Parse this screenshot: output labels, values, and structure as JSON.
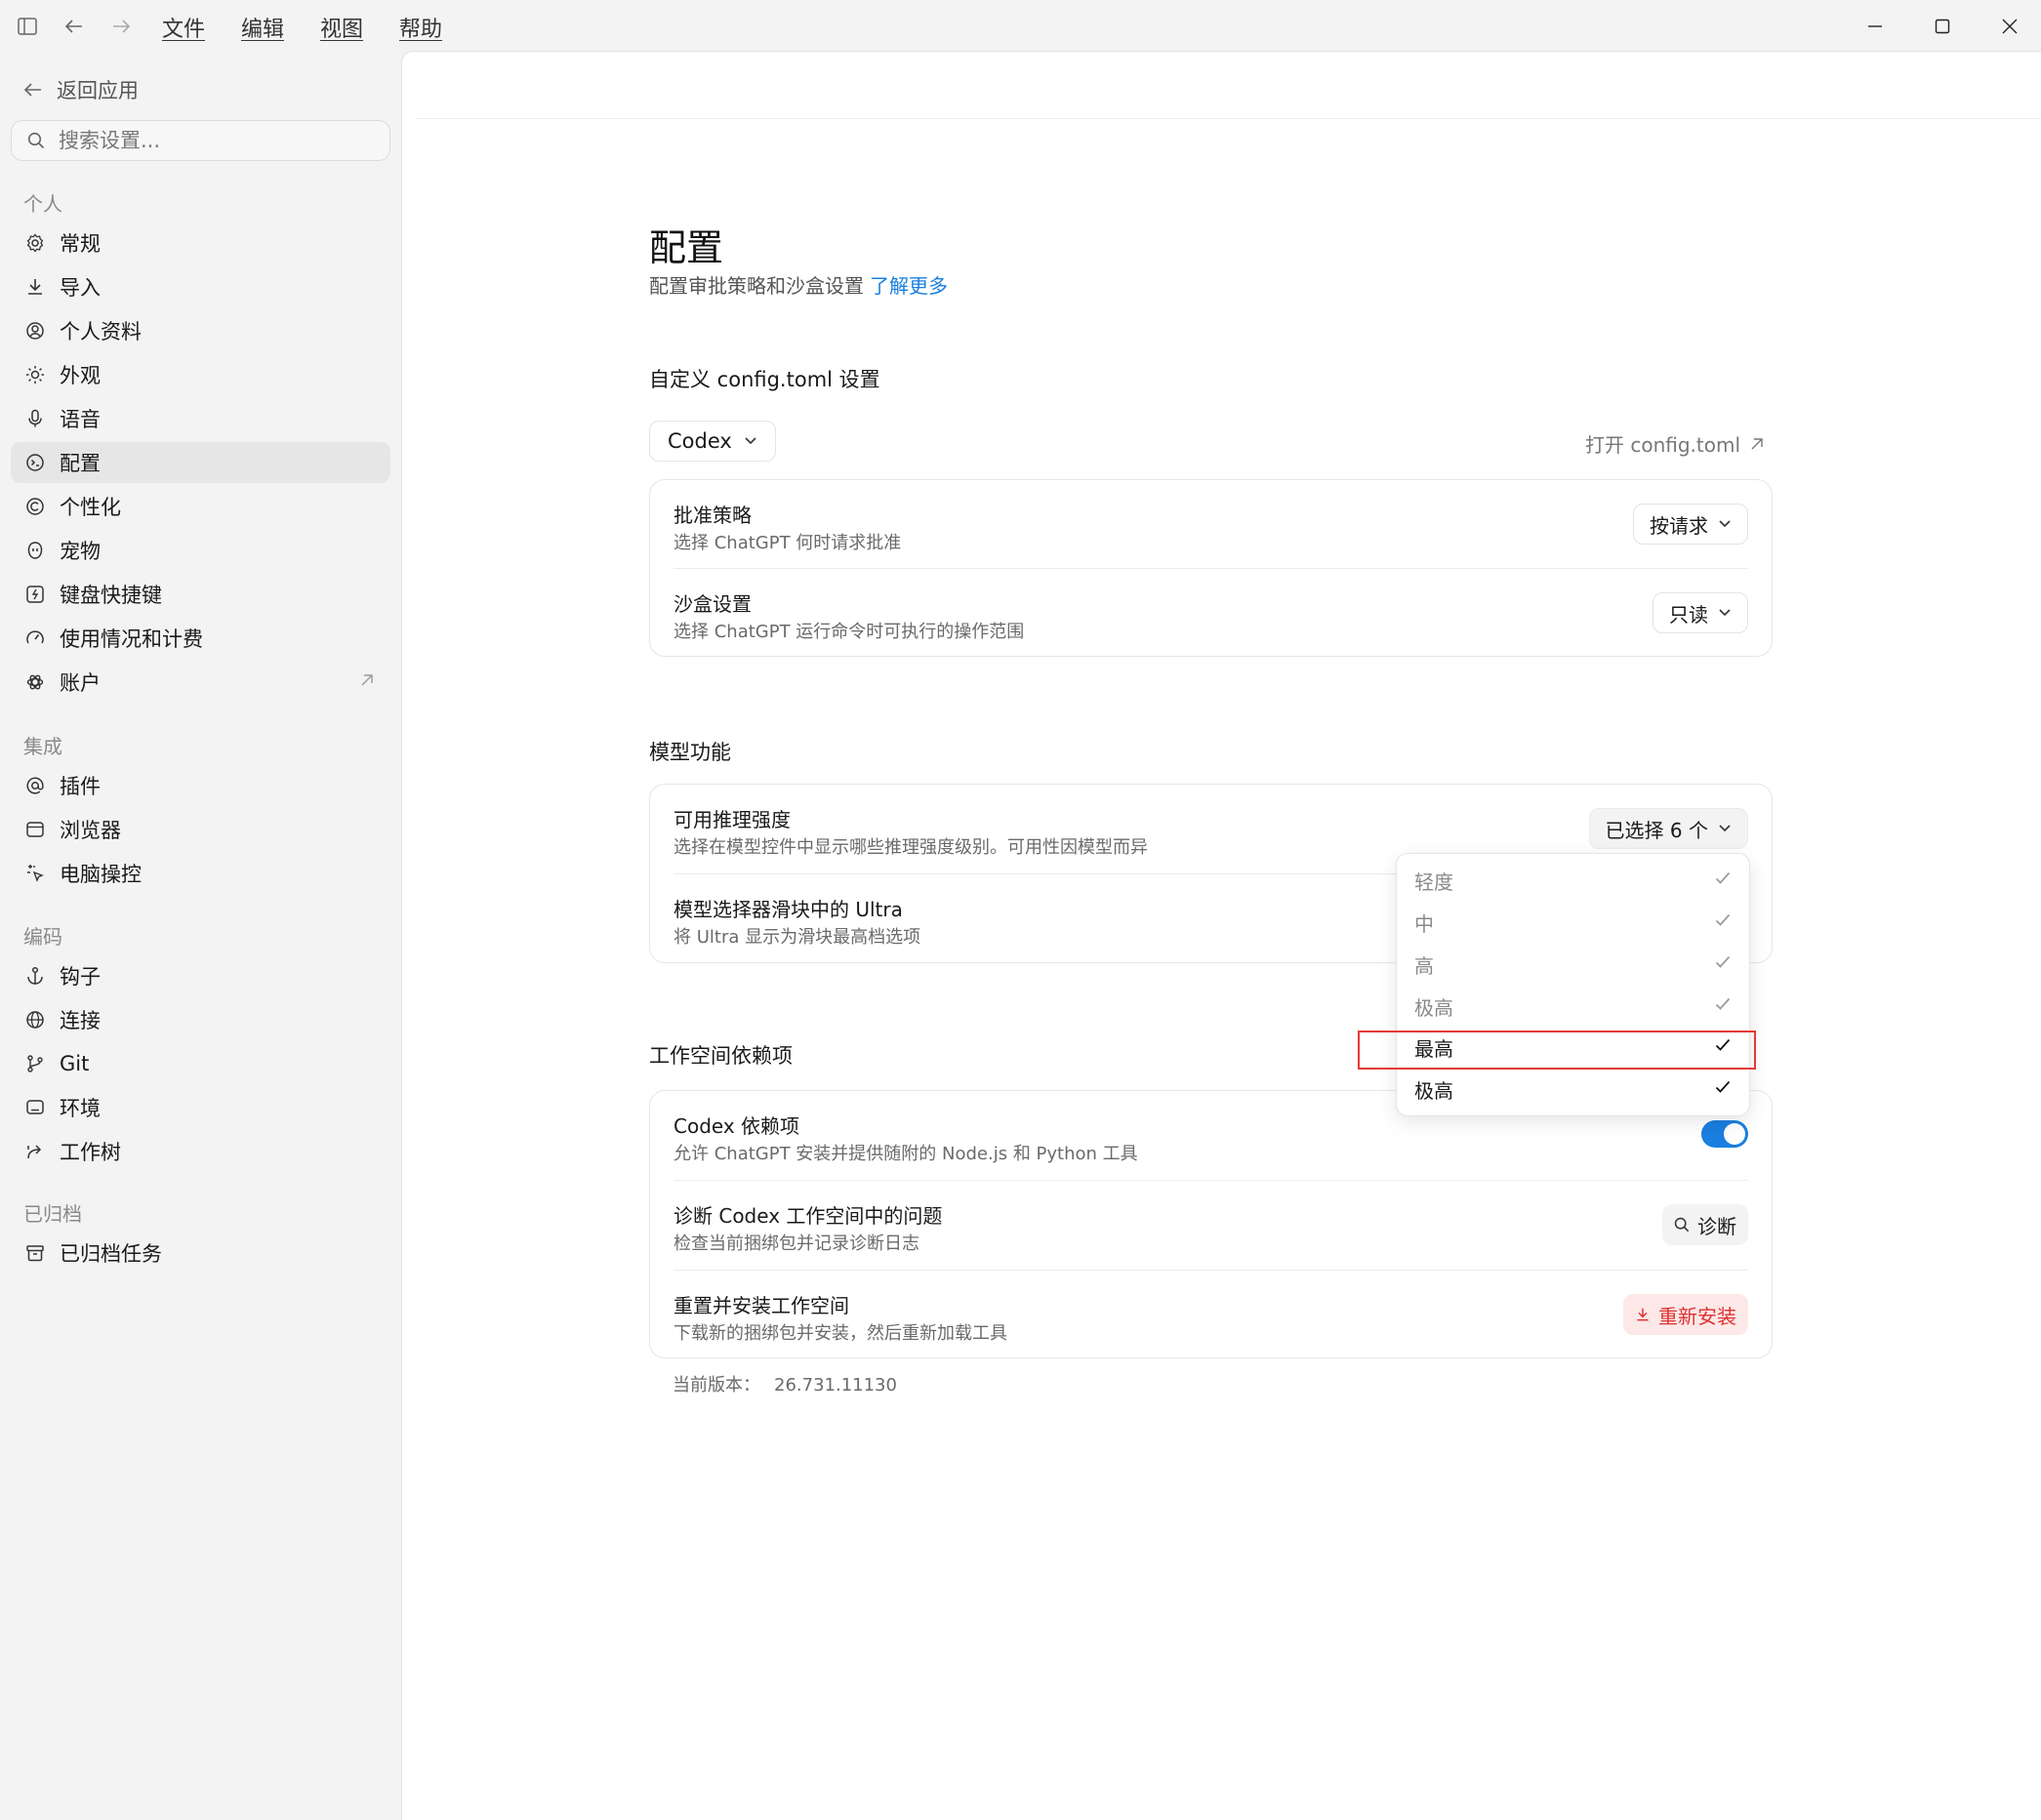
{
  "titlebar": {
    "menu": [
      "文件",
      "编辑",
      "视图",
      "帮助"
    ]
  },
  "sidebar": {
    "back_label": "返回应用",
    "search_placeholder": "搜索设置...",
    "sections": [
      {
        "label": "个人",
        "items": [
          {
            "label": "常规",
            "icon": "gear-icon"
          },
          {
            "label": "导入",
            "icon": "download-icon"
          },
          {
            "label": "个人资料",
            "icon": "profile-icon"
          },
          {
            "label": "外观",
            "icon": "sun-icon"
          },
          {
            "label": "语音",
            "icon": "mic-icon"
          },
          {
            "label": "配置",
            "icon": "config-icon",
            "active": true
          },
          {
            "label": "个性化",
            "icon": "personalize-icon"
          },
          {
            "label": "宠物",
            "icon": "pet-icon"
          },
          {
            "label": "键盘快捷键",
            "icon": "keyboard-icon"
          },
          {
            "label": "使用情况和计费",
            "icon": "gauge-icon"
          },
          {
            "label": "账户",
            "icon": "openai-icon",
            "external": true
          }
        ]
      },
      {
        "label": "集成",
        "items": [
          {
            "label": "插件",
            "icon": "at-icon"
          },
          {
            "label": "浏览器",
            "icon": "browser-icon"
          },
          {
            "label": "电脑操控",
            "icon": "cursor-sparkle-icon"
          }
        ]
      },
      {
        "label": "编码",
        "items": [
          {
            "label": "钩子",
            "icon": "anchor-icon"
          },
          {
            "label": "连接",
            "icon": "globe-icon"
          },
          {
            "label": "Git",
            "icon": "git-branch-icon"
          },
          {
            "label": "环境",
            "icon": "monitor-icon"
          },
          {
            "label": "工作树",
            "icon": "worktree-icon"
          }
        ]
      },
      {
        "label": "已归档",
        "items": [
          {
            "label": "已归档任务",
            "icon": "archive-icon"
          }
        ]
      }
    ]
  },
  "main": {
    "title": "配置",
    "subtitle": "配置审批策略和沙盒设置",
    "learn_more": "了解更多",
    "config_section": {
      "title": "自定义 config.toml 设置",
      "selector": "Codex",
      "open_link": "打开 config.toml",
      "rows": [
        {
          "title": "批准策略",
          "desc": "选择 ChatGPT 何时请求批准",
          "value": "按请求"
        },
        {
          "title": "沙盒设置",
          "desc": "选择 ChatGPT 运行命令时可执行的操作范围",
          "value": "只读"
        }
      ]
    },
    "model_section": {
      "title": "模型功能",
      "rows": [
        {
          "title": "可用推理强度",
          "desc": "选择在模型控件中显示哪些推理强度级别。可用性因模型而异",
          "value": "已选择 6 个"
        },
        {
          "title": "模型选择器滑块中的 Ultra",
          "desc": "将 Ultra 显示为滑块最高档选项"
        }
      ]
    },
    "workspace_section": {
      "title": "工作空间依赖项",
      "rows": [
        {
          "title": "Codex 依赖项",
          "desc": "允许 ChatGPT 安装并提供随附的 Node.js 和 Python 工具",
          "toggle": true
        },
        {
          "title": "诊断 Codex 工作空间中的问题",
          "desc": "检查当前捆绑包并记录诊断日志",
          "button": "诊断"
        },
        {
          "title": "重置并安装工作空间",
          "desc": "下载新的捆绑包并安装，然后重新加载工具",
          "button": "重新安装"
        }
      ]
    },
    "version_label": "当前版本：",
    "version_value": "26.731.11130"
  },
  "popup": {
    "items": [
      {
        "label": "轻度",
        "checked": true,
        "muted": true
      },
      {
        "label": "中",
        "checked": true,
        "muted": true
      },
      {
        "label": "高",
        "checked": true,
        "muted": true
      },
      {
        "label": "极高",
        "checked": true,
        "muted": true
      },
      {
        "label": "最高",
        "checked": true,
        "muted": false,
        "highlighted": true
      },
      {
        "label": "极高",
        "checked": true,
        "muted": false
      }
    ]
  },
  "colors": {
    "accent": "#1a7fe0",
    "danger": "#e03030",
    "highlight": "#e53935"
  }
}
